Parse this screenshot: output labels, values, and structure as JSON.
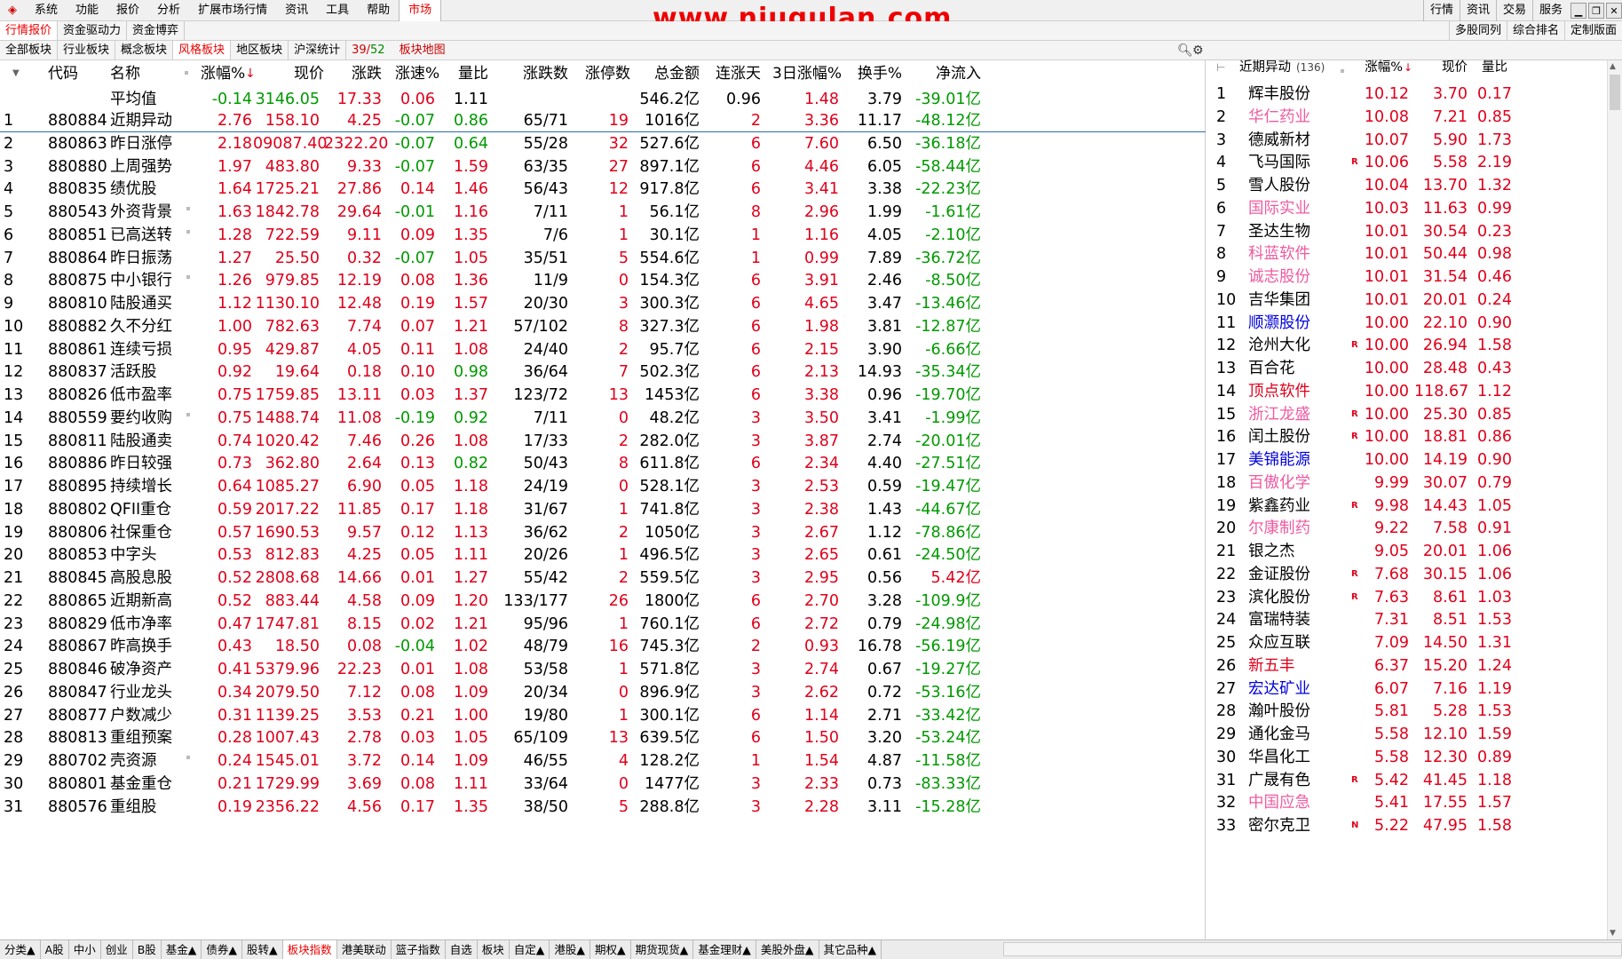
{
  "menu": [
    "系统",
    "功能",
    "报价",
    "分析",
    "扩展市场行情",
    "资讯",
    "工具",
    "帮助"
  ],
  "menu_active": "市场",
  "watermark": "www.niugulan.com",
  "top_right_buttons": [
    "行情",
    "资讯",
    "交易",
    "服务"
  ],
  "tabs_row2": [
    "行情报价",
    "资金驱动力",
    "资金博弈"
  ],
  "tabs_row2_right": [
    "多股同列",
    "综合排名",
    "定制版面"
  ],
  "tabs_row3": [
    "全部板块",
    "行业板块",
    "概念板块",
    "风格板块",
    "地区板块",
    "沪深统计"
  ],
  "tabs_row3_active": 3,
  "block_count_a": "39",
  "block_count_sep": "/",
  "block_count_b": "52",
  "block_map": "板块地图",
  "columns": [
    "代码",
    "名称",
    "涨幅%",
    "现价",
    "涨跌",
    "涨速%",
    "量比",
    "涨跌数",
    "涨停数",
    "总金额",
    "连涨天",
    "3日涨幅%",
    "换手%",
    "净流入"
  ],
  "avg_row": {
    "name": "平均值",
    "chg": "-0.14",
    "price": "3146.05",
    "diff": "17.33",
    "speed": "0.06",
    "vr": "1.11",
    "amount": "546.2亿",
    "days": "0.96",
    "chg3": "1.48",
    "turn": "3.79",
    "net": "-39.01亿"
  },
  "rows": [
    [
      "1",
      "880884",
      "近期异动",
      "2.76",
      "158.10",
      "4.25",
      "-0.07",
      "0.86",
      "65/71",
      "19",
      "1016亿",
      "2",
      "3.36",
      "11.17",
      "-48.12亿",
      0
    ],
    [
      "2",
      "880863",
      "昨日涨停",
      "2.18",
      "09087.40",
      "2322.20",
      "-0.07",
      "0.64",
      "55/28",
      "32",
      "527.6亿",
      "6",
      "7.60",
      "6.50",
      "-36.18亿",
      0
    ],
    [
      "3",
      "880880",
      "上周强势",
      "1.97",
      "483.80",
      "9.33",
      "-0.07",
      "1.59",
      "63/35",
      "27",
      "897.1亿",
      "6",
      "4.46",
      "6.05",
      "-58.44亿",
      0
    ],
    [
      "4",
      "880835",
      "绩优股",
      "1.64",
      "1725.21",
      "27.86",
      "0.14",
      "1.46",
      "56/43",
      "12",
      "917.8亿",
      "6",
      "3.41",
      "3.38",
      "-22.23亿",
      0
    ],
    [
      "5",
      "880543",
      "外资背景",
      "1.63",
      "1842.78",
      "29.64",
      "-0.01",
      "1.16",
      "7/11",
      "1",
      "56.1亿",
      "8",
      "2.96",
      "1.99",
      "-1.61亿",
      1
    ],
    [
      "6",
      "880851",
      "已高送转",
      "1.28",
      "722.59",
      "9.11",
      "0.09",
      "1.35",
      "7/6",
      "1",
      "30.1亿",
      "1",
      "1.16",
      "4.05",
      "-2.10亿",
      1
    ],
    [
      "7",
      "880864",
      "昨日振荡",
      "1.27",
      "25.50",
      "0.32",
      "-0.07",
      "1.05",
      "35/51",
      "5",
      "554.6亿",
      "1",
      "0.99",
      "7.89",
      "-36.72亿",
      0
    ],
    [
      "8",
      "880875",
      "中小银行",
      "1.26",
      "979.85",
      "12.19",
      "0.08",
      "1.36",
      "11/9",
      "0",
      "154.3亿",
      "6",
      "3.91",
      "2.46",
      "-8.50亿",
      1
    ],
    [
      "9",
      "880810",
      "陆股通买",
      "1.12",
      "1130.10",
      "12.48",
      "0.19",
      "1.57",
      "20/30",
      "3",
      "300.3亿",
      "6",
      "4.65",
      "3.47",
      "-13.46亿",
      0
    ],
    [
      "10",
      "880882",
      "久不分红",
      "1.00",
      "782.63",
      "7.74",
      "0.07",
      "1.21",
      "57/102",
      "8",
      "327.3亿",
      "6",
      "1.98",
      "3.81",
      "-12.87亿",
      0
    ],
    [
      "11",
      "880861",
      "连续亏损",
      "0.95",
      "429.87",
      "4.05",
      "0.11",
      "1.08",
      "24/40",
      "2",
      "95.7亿",
      "6",
      "2.15",
      "3.90",
      "-6.66亿",
      0
    ],
    [
      "12",
      "880837",
      "活跃股",
      "0.92",
      "19.64",
      "0.18",
      "0.10",
      "0.98",
      "36/64",
      "7",
      "502.3亿",
      "6",
      "2.13",
      "14.93",
      "-35.34亿",
      0
    ],
    [
      "13",
      "880826",
      "低市盈率",
      "0.75",
      "1759.85",
      "13.11",
      "0.03",
      "1.37",
      "123/72",
      "13",
      "1453亿",
      "6",
      "3.38",
      "0.96",
      "-19.70亿",
      0
    ],
    [
      "14",
      "880559",
      "要约收购",
      "0.75",
      "1488.74",
      "11.08",
      "-0.19",
      "0.92",
      "7/11",
      "0",
      "48.2亿",
      "3",
      "3.50",
      "3.41",
      "-1.99亿",
      1
    ],
    [
      "15",
      "880811",
      "陆股通卖",
      "0.74",
      "1020.42",
      "7.46",
      "0.26",
      "1.08",
      "17/33",
      "2",
      "282.0亿",
      "3",
      "3.87",
      "2.74",
      "-20.01亿",
      0
    ],
    [
      "16",
      "880886",
      "昨日较强",
      "0.73",
      "362.80",
      "2.64",
      "0.13",
      "0.82",
      "50/43",
      "8",
      "611.8亿",
      "6",
      "2.34",
      "4.40",
      "-27.51亿",
      0
    ],
    [
      "17",
      "880895",
      "持续增长",
      "0.64",
      "1085.27",
      "6.90",
      "0.05",
      "1.18",
      "24/19",
      "0",
      "528.1亿",
      "3",
      "2.53",
      "0.59",
      "-19.47亿",
      0
    ],
    [
      "18",
      "880802",
      "QFII重仓",
      "0.59",
      "2017.22",
      "11.85",
      "0.17",
      "1.18",
      "31/67",
      "1",
      "741.8亿",
      "3",
      "2.38",
      "1.43",
      "-44.67亿",
      0
    ],
    [
      "19",
      "880806",
      "社保重仓",
      "0.57",
      "1690.53",
      "9.57",
      "0.12",
      "1.13",
      "36/62",
      "2",
      "1050亿",
      "3",
      "2.67",
      "1.12",
      "-78.86亿",
      0
    ],
    [
      "20",
      "880853",
      "中字头",
      "0.53",
      "812.83",
      "4.25",
      "0.05",
      "1.11",
      "20/26",
      "1",
      "496.5亿",
      "3",
      "2.65",
      "0.61",
      "-24.50亿",
      0
    ],
    [
      "21",
      "880845",
      "高股息股",
      "0.52",
      "2808.68",
      "14.66",
      "0.01",
      "1.27",
      "55/42",
      "2",
      "559.5亿",
      "3",
      "2.95",
      "0.56",
      "5.42亿",
      0
    ],
    [
      "22",
      "880865",
      "近期新高",
      "0.52",
      "883.44",
      "4.58",
      "0.09",
      "1.20",
      "133/177",
      "26",
      "1800亿",
      "6",
      "2.70",
      "3.28",
      "-109.9亿",
      0
    ],
    [
      "23",
      "880829",
      "低市净率",
      "0.47",
      "1747.81",
      "8.15",
      "0.02",
      "1.21",
      "95/96",
      "1",
      "760.1亿",
      "6",
      "2.72",
      "0.79",
      "-24.98亿",
      0
    ],
    [
      "24",
      "880867",
      "昨高换手",
      "0.43",
      "18.50",
      "0.08",
      "-0.04",
      "1.02",
      "48/79",
      "16",
      "745.3亿",
      "2",
      "0.93",
      "16.78",
      "-56.19亿",
      0
    ],
    [
      "25",
      "880846",
      "破净资产",
      "0.41",
      "5379.96",
      "22.23",
      "0.01",
      "1.08",
      "53/58",
      "1",
      "571.8亿",
      "3",
      "2.74",
      "0.67",
      "-19.27亿",
      0
    ],
    [
      "26",
      "880847",
      "行业龙头",
      "0.34",
      "2079.50",
      "7.12",
      "0.08",
      "1.09",
      "20/34",
      "0",
      "896.9亿",
      "3",
      "2.62",
      "0.72",
      "-53.16亿",
      0
    ],
    [
      "27",
      "880877",
      "户数减少",
      "0.31",
      "1139.25",
      "3.53",
      "0.21",
      "1.00",
      "19/80",
      "1",
      "300.1亿",
      "6",
      "1.14",
      "2.71",
      "-33.42亿",
      0
    ],
    [
      "28",
      "880813",
      "重组预案",
      "0.28",
      "1007.43",
      "2.78",
      "0.03",
      "1.05",
      "65/109",
      "13",
      "639.5亿",
      "6",
      "1.50",
      "3.20",
      "-53.24亿",
      0
    ],
    [
      "29",
      "880702",
      "壳资源",
      "0.24",
      "1545.01",
      "3.72",
      "0.14",
      "1.09",
      "46/55",
      "4",
      "128.2亿",
      "1",
      "1.54",
      "4.87",
      "-11.58亿",
      1
    ],
    [
      "30",
      "880801",
      "基金重仓",
      "0.21",
      "1729.99",
      "3.69",
      "0.08",
      "1.11",
      "33/64",
      "0",
      "1477亿",
      "3",
      "2.33",
      "0.73",
      "-83.33亿",
      0
    ],
    [
      "31",
      "880576",
      "重组股",
      "0.19",
      "2356.22",
      "4.56",
      "0.17",
      "1.35",
      "38/50",
      "5",
      "288.8亿",
      "3",
      "2.28",
      "3.11",
      "-15.28亿",
      0
    ]
  ],
  "side": {
    "title": "近期异动",
    "count": "(136)",
    "columns": [
      "涨幅%",
      "现价",
      "量比"
    ],
    "rows": [
      [
        "1",
        "辉丰股份",
        "10.12",
        "3.70",
        "0.17",
        "b",
        ""
      ],
      [
        "2",
        "华仁药业",
        "10.08",
        "7.21",
        "0.85",
        "p",
        ""
      ],
      [
        "3",
        "德威新材",
        "10.07",
        "5.90",
        "1.73",
        "b",
        ""
      ],
      [
        "4",
        "飞马国际",
        "10.06",
        "5.58",
        "2.19",
        "b",
        "R"
      ],
      [
        "5",
        "雪人股份",
        "10.04",
        "13.70",
        "1.32",
        "b",
        ""
      ],
      [
        "6",
        "国际实业",
        "10.03",
        "11.63",
        "0.99",
        "p",
        ""
      ],
      [
        "7",
        "圣达生物",
        "10.01",
        "30.54",
        "0.23",
        "b",
        ""
      ],
      [
        "8",
        "科蓝软件",
        "10.01",
        "50.44",
        "0.98",
        "p",
        ""
      ],
      [
        "9",
        "诚志股份",
        "10.01",
        "31.54",
        "0.46",
        "p",
        ""
      ],
      [
        "10",
        "吉华集团",
        "10.01",
        "20.01",
        "0.24",
        "b",
        ""
      ],
      [
        "11",
        "顺灏股份",
        "10.00",
        "22.10",
        "0.90",
        "u",
        ""
      ],
      [
        "12",
        "沧州大化",
        "10.00",
        "26.94",
        "1.58",
        "b",
        "R"
      ],
      [
        "13",
        "百合花",
        "10.00",
        "28.48",
        "0.43",
        "b",
        ""
      ],
      [
        "14",
        "顶点软件",
        "10.00",
        "118.67",
        "1.12",
        "r",
        ""
      ],
      [
        "15",
        "浙江龙盛",
        "10.00",
        "25.30",
        "0.85",
        "p",
        "R"
      ],
      [
        "16",
        "闰土股份",
        "10.00",
        "18.81",
        "0.86",
        "b",
        "R"
      ],
      [
        "17",
        "美锦能源",
        "10.00",
        "14.19",
        "0.90",
        "u",
        ""
      ],
      [
        "18",
        "百傲化学",
        "9.99",
        "30.07",
        "0.79",
        "p",
        ""
      ],
      [
        "19",
        "紫鑫药业",
        "9.98",
        "14.43",
        "1.05",
        "b",
        "R"
      ],
      [
        "20",
        "尔康制药",
        "9.22",
        "7.58",
        "0.91",
        "p",
        ""
      ],
      [
        "21",
        "银之杰",
        "9.05",
        "20.01",
        "1.06",
        "b",
        ""
      ],
      [
        "22",
        "金证股份",
        "7.68",
        "30.15",
        "1.06",
        "b",
        "R"
      ],
      [
        "23",
        "滨化股份",
        "7.63",
        "8.61",
        "1.03",
        "b",
        "R"
      ],
      [
        "24",
        "富瑞特装",
        "7.31",
        "8.51",
        "1.53",
        "b",
        ""
      ],
      [
        "25",
        "众应互联",
        "7.09",
        "14.50",
        "1.31",
        "b",
        ""
      ],
      [
        "26",
        "新五丰",
        "6.37",
        "15.20",
        "1.24",
        "r",
        ""
      ],
      [
        "27",
        "宏达矿业",
        "6.07",
        "7.16",
        "1.19",
        "u",
        ""
      ],
      [
        "28",
        "瀚叶股份",
        "5.81",
        "5.28",
        "1.53",
        "b",
        ""
      ],
      [
        "29",
        "通化金马",
        "5.58",
        "12.10",
        "1.59",
        "b",
        ""
      ],
      [
        "30",
        "华昌化工",
        "5.58",
        "12.30",
        "0.89",
        "b",
        ""
      ],
      [
        "31",
        "广晟有色",
        "5.42",
        "41.45",
        "1.18",
        "b",
        "R"
      ],
      [
        "32",
        "中国应急",
        "5.41",
        "17.55",
        "1.57",
        "p",
        ""
      ],
      [
        "33",
        "密尔克卫",
        "5.22",
        "47.95",
        "1.58",
        "b",
        "N"
      ]
    ]
  },
  "bottom_tabs": [
    "分类▲",
    "A股",
    "中小",
    "创业",
    "B股",
    "基金▲",
    "债券▲",
    "股转▲",
    "板块指数",
    "港美联动",
    "篮子指数",
    "自选",
    "板块",
    "自定▲",
    "港股▲",
    "期权▲",
    "期货现货▲",
    "基金理财▲",
    "美股外盘▲",
    "其它品种▲"
  ],
  "bottom_active": 8,
  "colors": {
    "up": "#e0001b",
    "down": "#009900",
    "accent": "#e00000",
    "link": "#0000dd",
    "pink": "#f05aa0"
  }
}
